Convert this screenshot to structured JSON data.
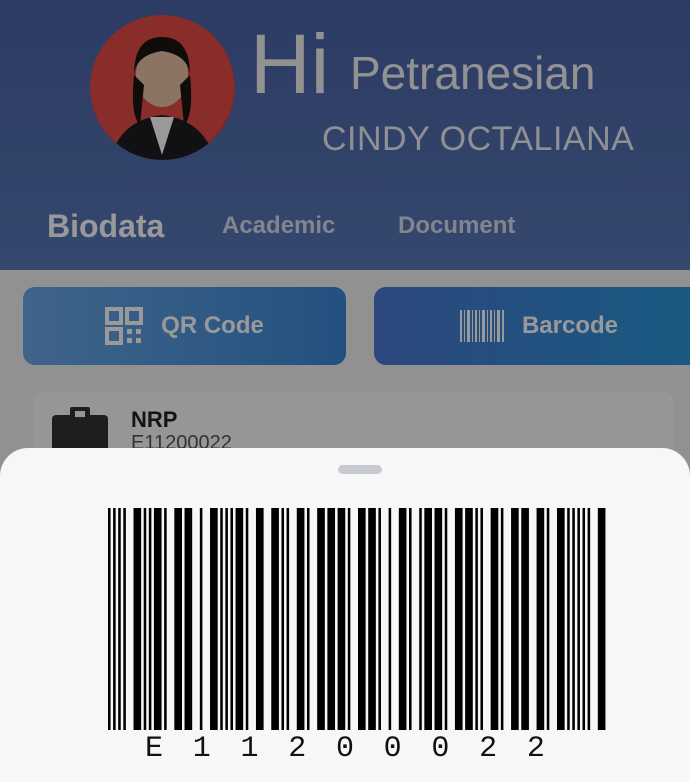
{
  "header": {
    "greeting_big": "Hi",
    "greeting_sub": "Petranesian",
    "student_name": "CINDY OCTALIANA"
  },
  "tabs": [
    {
      "label": "Biodata",
      "active": true
    },
    {
      "label": "Academic",
      "active": false
    },
    {
      "label": "Document",
      "active": false
    }
  ],
  "actions": {
    "qr_label": "QR Code",
    "barcode_label": "Barcode"
  },
  "card": {
    "label": "NRP",
    "value": "E11200022"
  },
  "barcode": {
    "value": "E11200022",
    "chars": [
      "E",
      "1",
      "1",
      "2",
      "0",
      "0",
      "0",
      "2",
      "2"
    ]
  },
  "colors": {
    "header": "#4a63a6",
    "button_from": "#6aa8e6",
    "button_to": "#3c86d6",
    "sheet": "#f7f7f7",
    "overlay": "rgba(0,0,0,0.40)"
  },
  "icons": {
    "qr": "qr-code-icon",
    "barcode": "barcode-icon",
    "id_card": "id-badge-icon"
  }
}
